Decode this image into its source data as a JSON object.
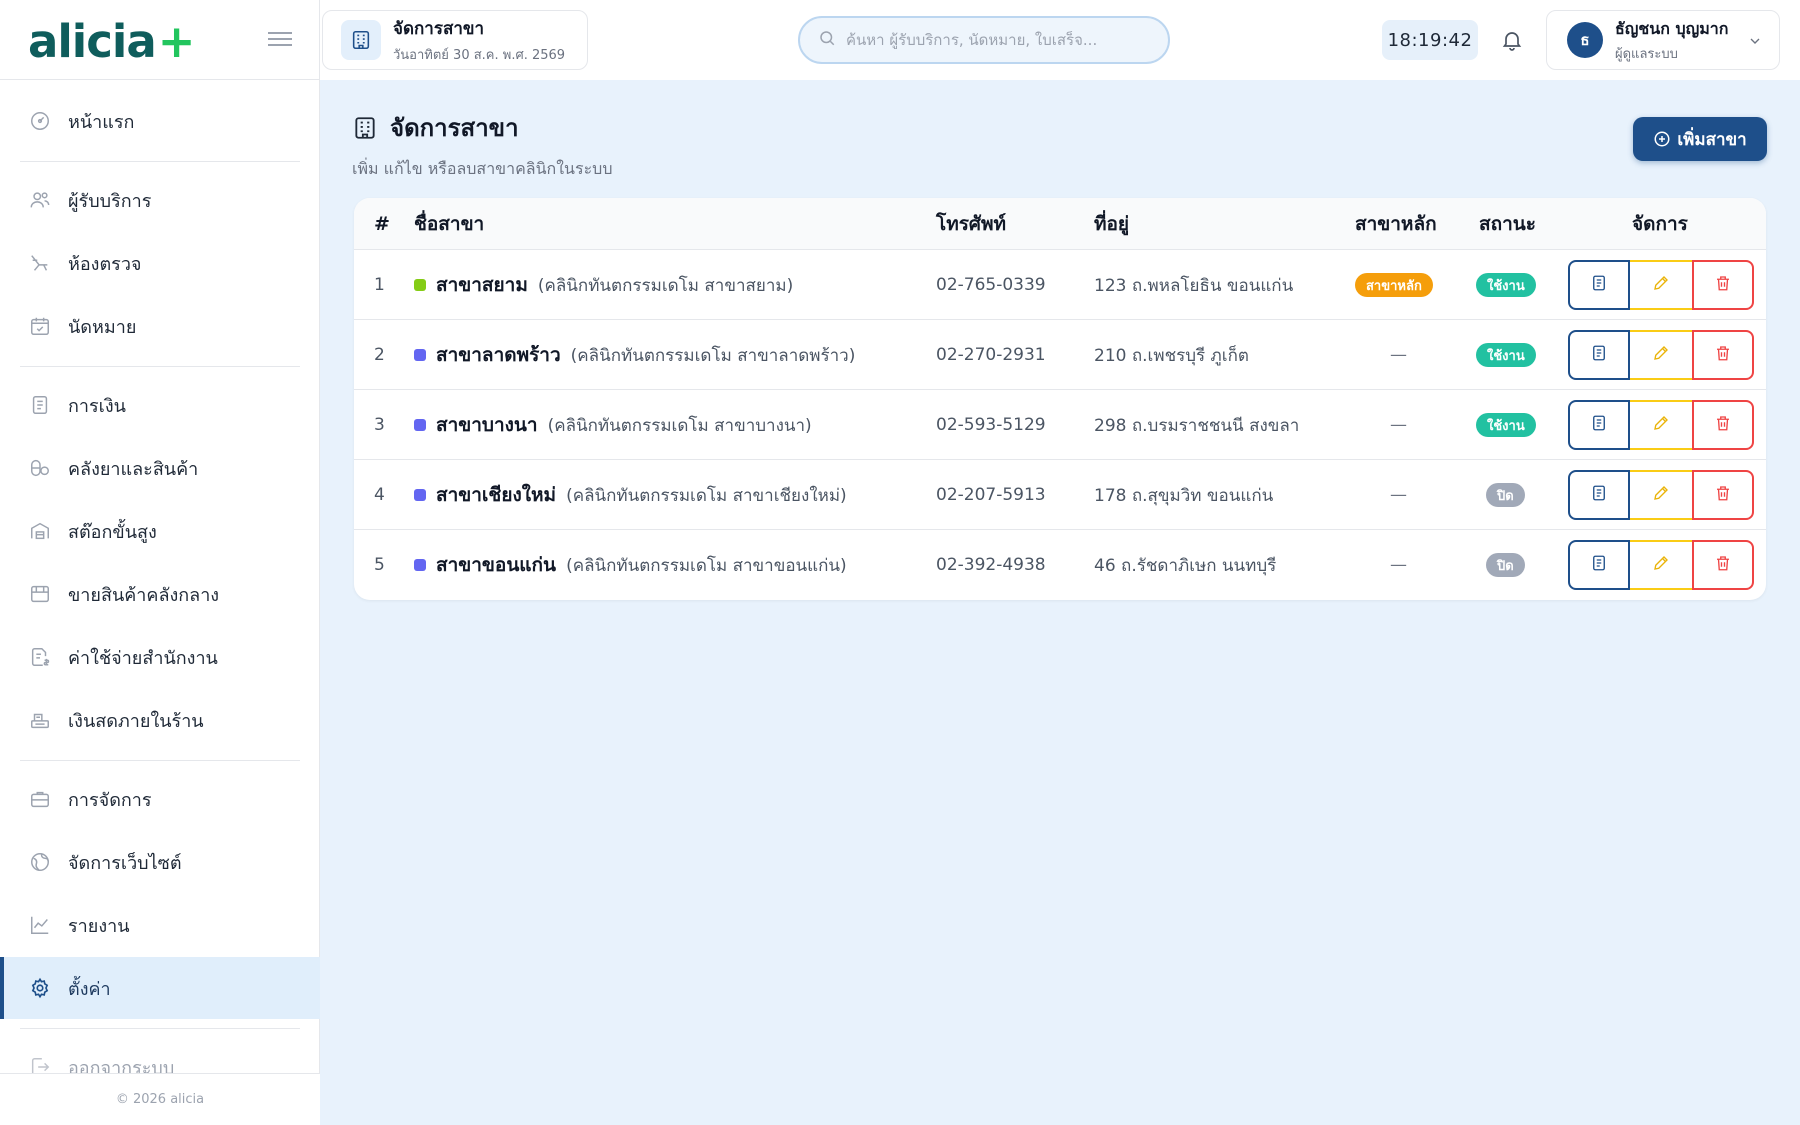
{
  "app": {
    "logo_text": "alicia",
    "logo_plus": "+"
  },
  "topbar": {
    "branch_title": "จัดการสาขา",
    "branch_date": "วันอาทิตย์ 30 ส.ค. พ.ศ. 2569",
    "search_placeholder": "ค้นหา ผู้รับบริการ, นัดหมาย, ใบเสร็จ...",
    "clock": "18:19:42",
    "user_initial": "ธ",
    "user_name": "ธัญชนก บุญมาก",
    "user_role": "ผู้ดูแลระบบ"
  },
  "sidebar": {
    "items": [
      {
        "label": "หน้าแรก",
        "icon": "dashboard-icon"
      },
      {
        "label": "ผู้รับบริการ",
        "icon": "users-icon"
      },
      {
        "label": "ห้องตรวจ",
        "icon": "dental-chair-icon"
      },
      {
        "label": "นัดหมาย",
        "icon": "calendar-check-icon"
      },
      {
        "label": "การเงิน",
        "icon": "receipt-icon"
      },
      {
        "label": "คลังยาและสินค้า",
        "icon": "pills-icon"
      },
      {
        "label": "สต๊อกขั้นสูง",
        "icon": "warehouse-icon"
      },
      {
        "label": "ขายสินค้าคลังกลาง",
        "icon": "store-icon"
      },
      {
        "label": "ค่าใช้จ่ายสำนักงาน",
        "icon": "expense-icon"
      },
      {
        "label": "เงินสดภายในร้าน",
        "icon": "cash-register-icon"
      },
      {
        "label": "การจัดการ",
        "icon": "briefcase-icon"
      },
      {
        "label": "จัดการเว็บไซต์",
        "icon": "globe-icon"
      },
      {
        "label": "รายงาน",
        "icon": "chart-line-icon"
      },
      {
        "label": "ตั้งค่า",
        "icon": "gear-icon"
      },
      {
        "label": "ออกจากระบบ",
        "icon": "logout-icon"
      }
    ],
    "footer": "© 2026 alicia"
  },
  "page": {
    "title": "จัดการสาขา",
    "subtitle": "เพิ่ม แก้ไข หรือลบสาขาคลินิกในระบบ",
    "add_button": "เพิ่มสาขา"
  },
  "table": {
    "headers": {
      "num": "#",
      "name": "ชื่อสาขา",
      "phone": "โทรศัพท์",
      "address": "ที่อยู่",
      "main": "สาขาหลัก",
      "status": "สถานะ",
      "actions": "จัดการ"
    },
    "rows": [
      {
        "num": "1",
        "name": "สาขาสยาม",
        "full": "(คลินิกทันตกรรมเดโม สาขาสยาม)",
        "phone": "02-765-0339",
        "address": "123 ถ.พหลโยธิน ขอนแก่น",
        "main": "สาขาหลัก",
        "status": "ใช้งาน",
        "dot": "#84cc16"
      },
      {
        "num": "2",
        "name": "สาขาลาดพร้าว",
        "full": "(คลินิกทันตกรรมเดโม สาขาลาดพร้าว)",
        "phone": "02-270-2931",
        "address": "210 ถ.เพชรบุรี ภูเก็ต",
        "main": "—",
        "status": "ใช้งาน",
        "dot": "#6366f1"
      },
      {
        "num": "3",
        "name": "สาขาบางนา",
        "full": "(คลินิกทันตกรรมเดโม สาขาบางนา)",
        "phone": "02-593-5129",
        "address": "298 ถ.บรมราชชนนี สงขลา",
        "main": "—",
        "status": "ใช้งาน",
        "dot": "#6366f1"
      },
      {
        "num": "4",
        "name": "สาขาเชียงใหม่",
        "full": "(คลินิกทันตกรรมเดโม สาขาเชียงใหม่)",
        "phone": "02-207-5913",
        "address": "178 ถ.สุขุมวิท ขอนแก่น",
        "main": "—",
        "status": "ปิด",
        "dot": "#6366f1"
      },
      {
        "num": "5",
        "name": "สาขาขอนแก่น",
        "full": "(คลินิกทันตกรรมเดโม สาขาขอนแก่น)",
        "phone": "02-392-4938",
        "address": "46 ถ.รัชดาภิเษก นนทบุรี",
        "main": "—",
        "status": "ปิด",
        "dot": "#6366f1"
      }
    ]
  },
  "colors": {
    "primary": "#1e4f8a",
    "logo": "#0f5d5c",
    "accent": "#22c55e",
    "main_badge": "#f59e0b",
    "active_badge": "#22c1a1",
    "closed_badge": "#a1a9b8",
    "edit": "#facc15",
    "delete": "#ef4444"
  }
}
